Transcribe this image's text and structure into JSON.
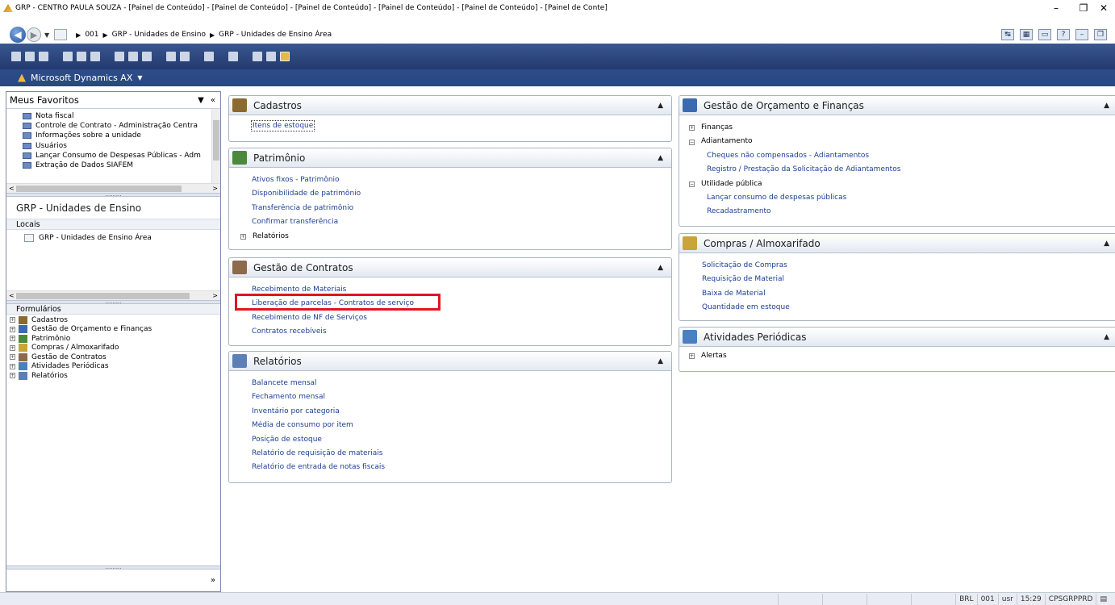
{
  "window": {
    "title": "GRP - CENTRO PAULA SOUZA - [Painel de Conteúdo] - [Painel de Conteúdo] - [Painel de Conteúdo] - [Painel de Conteúdo] - [Painel de Conteúdo] - [Painel de Conte]",
    "minimize": "–",
    "restore": "❐",
    "close": "✕"
  },
  "address": {
    "crumbs": [
      "001",
      "GRP - Unidades de Ensino",
      "GRP - Unidades de Ensino Área"
    ]
  },
  "appbar": {
    "title": "Microsoft Dynamics AX"
  },
  "sidebar": {
    "favorites_title": "Meus Favoritos",
    "favorites": [
      "Nota fiscal",
      "Controle de Contrato - Administração Centra",
      "Informações sobre a unidade",
      "Usuários",
      "Lançar Consumo de Despesas Públicas - Adm",
      "Extração de Dados SIAFEM"
    ],
    "unit_title": "GRP - Unidades de Ensino",
    "locais_label": "Locais",
    "locais_item": "GRP - Unidades de Ensino Área",
    "forms_label": "Formulários",
    "forms": [
      {
        "label": "Cadastros",
        "icon": "cadastros-icon",
        "color": "#8a6a2e"
      },
      {
        "label": "Gestão de Orçamento e Finanças",
        "icon": "financas-icon",
        "color": "#3c6ab0"
      },
      {
        "label": "Patrimônio",
        "icon": "patrimonio-icon",
        "color": "#4a8a3a"
      },
      {
        "label": "Compras / Almoxarifado",
        "icon": "compras-icon",
        "color": "#c9a43a"
      },
      {
        "label": "Gestão de Contratos",
        "icon": "contratos-icon",
        "color": "#8d6a4a"
      },
      {
        "label": "Atividades Periódicas",
        "icon": "atividades-icon",
        "color": "#4a7fc0"
      },
      {
        "label": "Relatórios",
        "icon": "relatorios-icon",
        "color": "#5d7fb8"
      }
    ]
  },
  "panels": {
    "cadastros": {
      "title": "Cadastros",
      "links": [
        "Itens de estoque"
      ]
    },
    "patrimonio": {
      "title": "Patrimônio",
      "links": [
        "Ativos fixos - Patrimônio",
        "Disponibilidade de patrimônio",
        "Transferência de patrimônio",
        "Confirmar transferência"
      ],
      "node": "Relatórios"
    },
    "contratos": {
      "title": "Gestão de Contratos",
      "links": [
        "Recebimento de Materiais",
        "Liberação de parcelas - Contratos de serviço",
        "Recebimento de NF de Serviços",
        "Contratos recebíveis"
      ]
    },
    "relatorios": {
      "title": "Relatórios",
      "links": [
        "Balancete mensal",
        "Fechamento mensal",
        "Inventário por categoria",
        "Média de consumo por item",
        "Posição de estoque",
        "Relatório de requisição de materiais",
        "Relatório de entrada de notas fiscais"
      ]
    },
    "orcamento": {
      "title": "Gestão de Orçamento e Finanças",
      "node1": "Finanças",
      "node2": "Adiantamento",
      "node2_links": [
        "Cheques não compensados - Adiantamentos",
        "Registro / Prestação da Solicitação de Adiantamentos"
      ],
      "node3": "Utilidade pública",
      "node3_links": [
        "Lançar consumo de despesas públicas",
        "Recadastramento"
      ]
    },
    "compras": {
      "title": "Compras / Almoxarifado",
      "links": [
        "Solicitação de Compras",
        "Requisição de Material",
        "Baixa de Material",
        "Quantidade em estoque"
      ]
    },
    "atividades": {
      "title": "Atividades Periódicas",
      "node": "Alertas"
    }
  },
  "status": {
    "lang": "BRL",
    "company": "001",
    "user": "usr",
    "time": "15:29",
    "server": "CPSGRPPRD"
  },
  "colors": {
    "highlight": "#e0161e",
    "link": "#1c3f94",
    "appbar": "#2d4c8a"
  }
}
